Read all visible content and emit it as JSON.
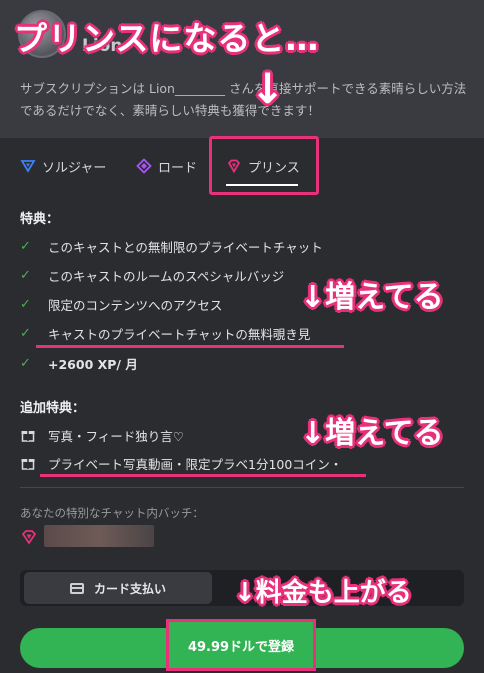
{
  "header": {
    "name": "Lion",
    "description": "サブスクリプションは Lion________ さんを直接サポートできる素晴らしい方法であるだけでなく、素晴らしい特典も獲得できます！"
  },
  "overlays": {
    "title": "プリンスになると…",
    "arrow": "↓",
    "increase_1": "↓増えてる",
    "increase_2": "↓増えてる",
    "price_up": "↓料金も上がる"
  },
  "tabs": [
    {
      "label": "ソルジャー",
      "icon": "triangle-icon",
      "color": "#3b82f6"
    },
    {
      "label": "ロード",
      "icon": "diamond-icon",
      "color": "#a855f7"
    },
    {
      "label": "プリンス",
      "icon": "gem-icon",
      "color": "#e8317b",
      "selected": true
    }
  ],
  "benefits": {
    "title": "特典：",
    "items": [
      "このキャストとの無制限のプライベートチャット",
      "このキャストのルームのスペシャルバッジ",
      "限定のコンテンツへのアクセス",
      "キャストのプライベートチャットの無料覗き見",
      "+2600 XP/ 月"
    ]
  },
  "extra_benefits": {
    "title": "追加特典：",
    "items": [
      "写真・フィード独り言♡",
      "プライベート写真動画・限定プラベ1分100コイン・"
    ]
  },
  "badge": {
    "label": "あなたの特別なチャット内バッチ："
  },
  "payment": {
    "card_label": "カード支払い",
    "subscribe_label": "49.99ドルで登録"
  },
  "colors": {
    "accent_pink": "#e8317b",
    "check_green": "#4caf50",
    "subscribe_green": "#32b455"
  }
}
